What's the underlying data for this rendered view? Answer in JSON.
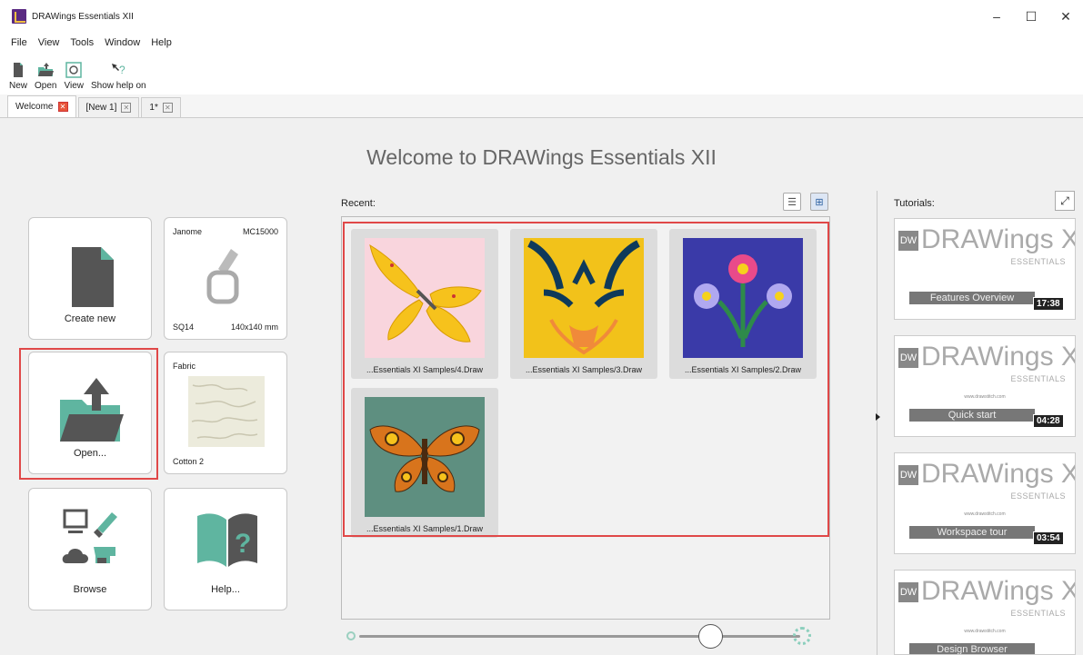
{
  "window": {
    "title": "DRAWings Essentials XII",
    "minimize": "–",
    "maximize": "☐",
    "close": "✕"
  },
  "menu": [
    "File",
    "View",
    "Tools",
    "Window",
    "Help"
  ],
  "toolbar": [
    {
      "label": "New",
      "icon": "new-document-icon"
    },
    {
      "label": "Open",
      "icon": "open-folder-icon"
    },
    {
      "label": "View",
      "icon": "view-icon"
    },
    {
      "label": "Show help on",
      "icon": "help-pointer-icon"
    }
  ],
  "tabs": [
    {
      "label": "Welcome",
      "active": true
    },
    {
      "label": "[New 1]",
      "active": false
    },
    {
      "label": "1*",
      "active": false
    }
  ],
  "welcome_title": "Welcome to DRAWings Essentials XII",
  "tiles": {
    "create_new": "Create new",
    "machine": {
      "brand": "Janome",
      "model": "MC15000",
      "hoop": "SQ14",
      "size": "140x140 mm"
    },
    "open": "Open...",
    "fabric": {
      "label": "Fabric",
      "name": "Cotton 2"
    },
    "browse": "Browse",
    "help": "Help..."
  },
  "recent": {
    "label": "Recent:",
    "items": [
      {
        "caption": "...Essentials XI Samples/4.Draw",
        "bg": "#f9d5dd",
        "subject": "yellow-butterfly"
      },
      {
        "caption": "...Essentials XI Samples/3.Draw",
        "bg": "#f2c21a",
        "subject": "tribal-tiger"
      },
      {
        "caption": "...Essentials XI Samples/2.Draw",
        "bg": "#3a3aa8",
        "subject": "flowers"
      },
      {
        "caption": "...Essentials XI Samples/1.Draw",
        "bg": "#5e8f80",
        "subject": "moth"
      }
    ]
  },
  "tutorials": {
    "label": "Tutorials:",
    "logo_text": "DRAWings",
    "logo_version": "XI",
    "logo_sub": "ESSENTIALS",
    "url": "www.drawstitch.com",
    "items": [
      {
        "title": "Features Overview",
        "duration": "17:38"
      },
      {
        "title": "Quick start",
        "duration": "04:28"
      },
      {
        "title": "Workspace tour",
        "duration": "03:54"
      },
      {
        "title": "Design Browser",
        "duration": ""
      }
    ]
  },
  "colors": {
    "accent": "#5fb5a0",
    "highlight": "#e04848",
    "brand": "#5a2a82"
  }
}
